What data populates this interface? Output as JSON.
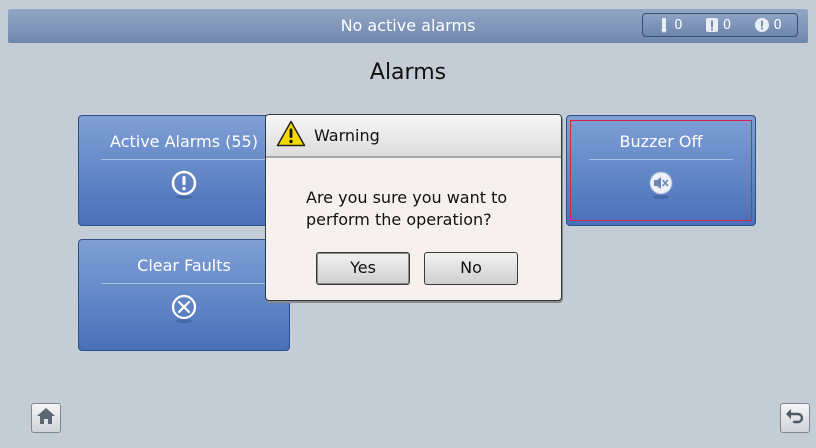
{
  "header": {
    "status_text": "No active alarms",
    "counters": [
      {
        "icon": "critical-alarm-icon",
        "value": "0"
      },
      {
        "icon": "major-alarm-icon",
        "value": "0"
      },
      {
        "icon": "minor-alarm-icon",
        "value": "0"
      }
    ]
  },
  "page": {
    "title": "Alarms"
  },
  "tiles": {
    "active_alarms": {
      "label": "Active Alarms (55)",
      "icon": "exclamation-circle-icon"
    },
    "clear_faults": {
      "label": "Clear Faults",
      "icon": "x-circle-icon"
    },
    "buzzer_off": {
      "label": "Buzzer Off",
      "icon": "speaker-mute-icon"
    }
  },
  "dialog": {
    "title": "Warning",
    "icon": "warning-triangle-icon",
    "message_line1": "Are you sure you want to",
    "message_line2": "perform the operation?",
    "yes_label": "Yes",
    "no_label": "No"
  },
  "nav": {
    "home_icon": "home-icon",
    "back_icon": "back-arrow-icon"
  },
  "colors": {
    "tile_blue": "#5a7ec3",
    "selection_red": "#d6224a",
    "warning_yellow": "#f5d800"
  }
}
